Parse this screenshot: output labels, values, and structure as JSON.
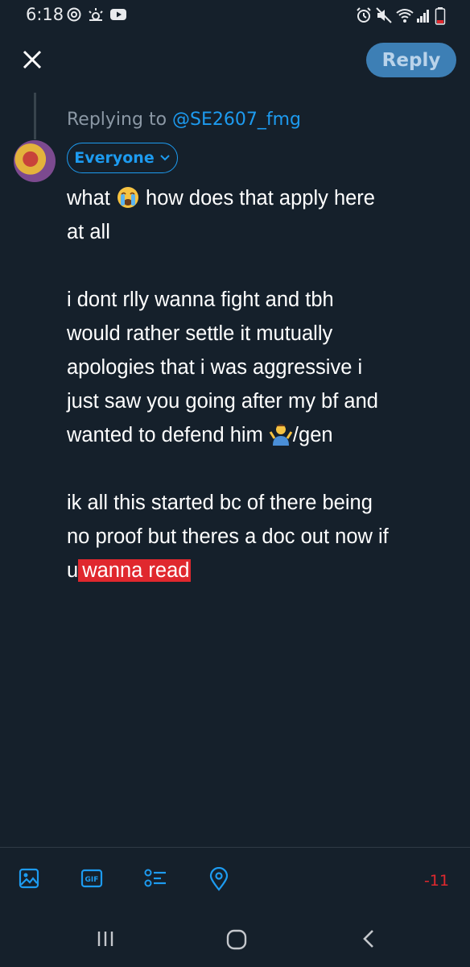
{
  "status_bar": {
    "time": "6:18"
  },
  "header": {
    "reply_label": "Reply"
  },
  "compose": {
    "replying_prefix": "Replying to ",
    "replying_handle": "@SE2607_fmg",
    "audience_label": "Everyone",
    "paragraph1_line1_pre": "what ",
    "paragraph1_line1_post": " how does that apply here",
    "paragraph1_line2": "at all",
    "paragraph2_lines": [
      "i dont rlly wanna fight and tbh",
      "would rather settle it mutually",
      "apologies that i was aggressive i",
      "just saw you going after my bf and"
    ],
    "paragraph2_last_pre": "wanted to defend him ",
    "paragraph2_last_post": "/gen",
    "paragraph3_lines": [
      "ik all this started bc of there being",
      "no proof but theres a doc out now if"
    ],
    "paragraph3_last_pre": "u",
    "paragraph3_highlight": "wanna read"
  },
  "toolbar": {
    "icons": [
      "image-icon",
      "gif-icon",
      "poll-icon",
      "location-icon"
    ],
    "gif_text": "GIF",
    "char_count": "-11"
  },
  "colors": {
    "background": "#15202b",
    "accent": "#1d9bf0",
    "reply_button": "#3d7fb5",
    "highlight": "#e0282e",
    "muted_text": "#8b98a5"
  }
}
